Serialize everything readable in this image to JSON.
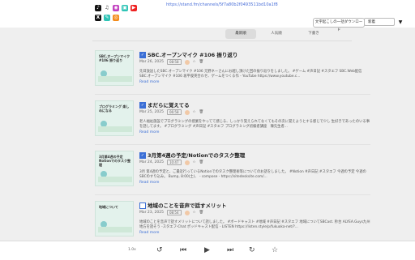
{
  "browser": {
    "url": "https://stand.fm/channels/5f7a80b2f0493511bd10a1f8"
  },
  "social": [
    "tiktok-icon",
    "music-icon",
    "podcast-icon",
    "app-icon",
    "youtube-icon",
    "x-icon",
    "note-icon",
    "rss-icon"
  ],
  "toolbar": {
    "download_label": "文字起こしの一括ダウンロード",
    "sort_label": "新着"
  },
  "tabs": [
    "最新順",
    "人気順",
    "下書き"
  ],
  "episodes": [
    {
      "thumb": "SBC.オープンマイク #106 振り返り",
      "title": "SBC.オープンマイク #106 振り返り",
      "date": "Mar 26, 2025",
      "duration": "08:58",
      "desc": "先日放送したSBC.オープンマイク #106 元野ネーさんにお越し頂けた回の振り返りをしました。 #ゲーム #声日記 #スタエフ SBC.Web配信 SBC.オープンマイク #106 坂平俊英合わせ、ゲームをつくる作 - YouTube https://www.youtube.c...",
      "more": "Read more"
    },
    {
      "thumb": "プログラミング 楽しめになる",
      "title": "まだらに覚えてる",
      "date": "Mar 25, 2025",
      "duration": "06:58",
      "desc": "老人福祉施設でプログラミングの授業をやってて感じる、しっかり覚えられてなくてもその次に覚えようとする感じで少し 生好きであったのいる事を話してます。 #プログラミング #声日記 #スタエフ プログラミング初級者講座　陳先生者...",
      "more": "Read more"
    },
    {
      "thumb": "3月第4週の予定 Notionでのタスク整理",
      "title": "3月第4週の予定/Notionでのタスク整理",
      "date": "Mar 24, 2025",
      "duration": "10:47",
      "desc": "3月 第4週の予定と、ご最近行っているNotionでのタスク整理術等についてのお話をしました。 #Notion #声日記 #スタエフ 今週の予定 今週のSBCのすり込み。 Bump, 8:00(土)、 - compose - https://sitedesksite.com/...",
      "more": "Read more"
    },
    {
      "thumb": "地域について",
      "title": "地域のことを音声で話すメリット",
      "date": "Mar 23, 2025",
      "duration": "08:54",
      "desc": "地域のことを音声で話すメリットについて話しました。 #ボードキャスト #地域 #声日記 #スタエフ 地域についてSBCast. 秒台 ALYEA.Guys九州地方を話そう -スタエフ-Chat ポッドキャスト配信 - LISTEN https://listen.style/p/fukuoka-net/?...",
      "more": "Read more"
    }
  ],
  "player": {
    "speed": "1.0x"
  }
}
